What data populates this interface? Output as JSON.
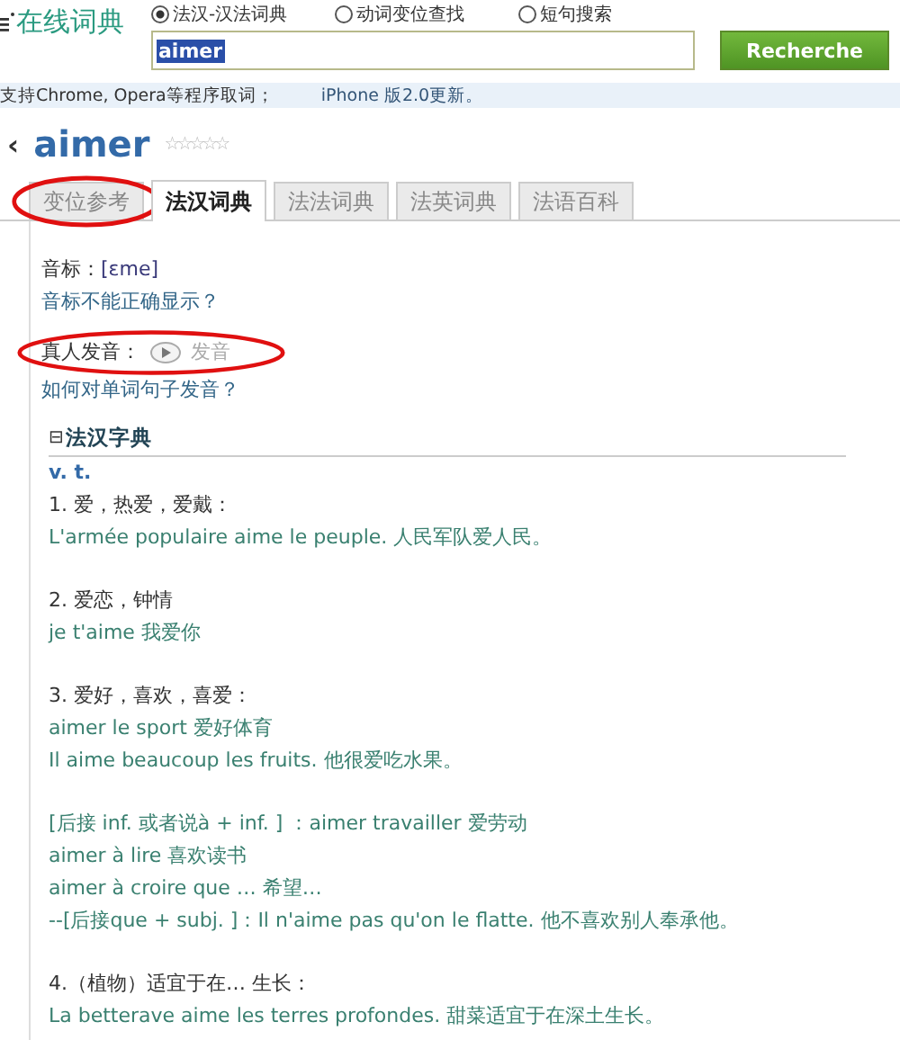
{
  "logo": "在线词典",
  "search_modes": [
    {
      "label": "法汉-汉法词典",
      "selected": true
    },
    {
      "label": "动词变位查找",
      "selected": false
    },
    {
      "label": "短句搜索",
      "selected": false
    }
  ],
  "search": {
    "value": "aimer",
    "button": "Recherche"
  },
  "info_bar": [
    "支持Chrome, Opera等程序取词；",
    "iPhone 版2.0更新。"
  ],
  "word": {
    "back": "‹",
    "headword": "aimer",
    "stars": 0
  },
  "tabs": [
    {
      "label": "变位参考",
      "selected": false,
      "circled": true
    },
    {
      "label": "法汉词典",
      "selected": true,
      "circled": false
    },
    {
      "label": "法法词典",
      "selected": false,
      "circled": false
    },
    {
      "label": "法英词典",
      "selected": false,
      "circled": false
    },
    {
      "label": "法语百科",
      "selected": false,
      "circled": false
    }
  ],
  "phonetic": {
    "label": "音标：",
    "value": "[ɛme]",
    "help_link": "音标不能正确显示？"
  },
  "audio": {
    "label": "真人发音：",
    "button": "发音",
    "circled": true,
    "help_link": "如何对单词句子发音？"
  },
  "section": {
    "toggle": "⊟",
    "title": "法汉字典",
    "pos": "v. t."
  },
  "groups": [
    [
      {
        "kind": "sense",
        "text": "1. 爱，热爱，爱戴："
      },
      {
        "kind": "example",
        "text": "L'armée populaire aime le peuple. 人民军队爱人民。"
      }
    ],
    [
      {
        "kind": "sense",
        "text": "2. 爱恋，钟情"
      },
      {
        "kind": "example",
        "text": "je t'aime 我爱你"
      }
    ],
    [
      {
        "kind": "sense",
        "text": "3. 爱好，喜欢，喜爱："
      },
      {
        "kind": "example",
        "text": "aimer le sport 爱好体育"
      },
      {
        "kind": "example",
        "text": "Il aime beaucoup les fruits. 他很爱吃水果。"
      }
    ],
    [
      {
        "kind": "example",
        "text": "[后接 inf. 或者说à + inf. ] ：aimer travailler 爱劳动"
      },
      {
        "kind": "example",
        "text": "aimer à lire 喜欢读书"
      },
      {
        "kind": "example",
        "text": "aimer à croire que … 希望…"
      },
      {
        "kind": "example",
        "text": "--[后接que + subj. ]：Il n'aime pas qu'on le flatte. 他不喜欢别人奉承他。"
      }
    ],
    [
      {
        "kind": "sense",
        "text": "4.（植物）适宜于在… 生长："
      },
      {
        "kind": "example",
        "text": "La betterave aime les terres profondes. 甜菜适宜于在深土生长。"
      }
    ]
  ]
}
